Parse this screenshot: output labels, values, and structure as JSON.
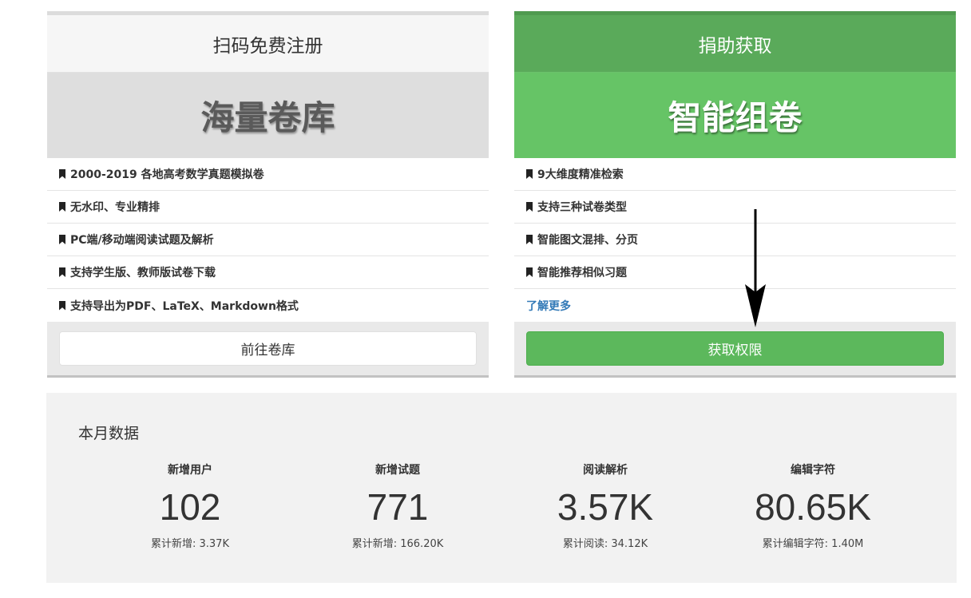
{
  "left_panel": {
    "header": "扫码免费注册",
    "hero": "海量卷库",
    "features": [
      "2000-2019 各地高考数学真题模拟卷",
      "无水印、专业精排",
      "PC端/移动端阅读试题及解析",
      "支持学生版、教师版试卷下载",
      "支持导出为PDF、LaTeX、Markdown格式"
    ],
    "button": "前往卷库"
  },
  "right_panel": {
    "header": "捐助获取",
    "hero": "智能组卷",
    "features": [
      "9大维度精准检索",
      "支持三种试卷类型",
      "智能图文混排、分页",
      "智能推荐相似习题"
    ],
    "more_link": "了解更多",
    "button": "获取权限"
  },
  "stats": {
    "title": "本月数据",
    "items": [
      {
        "label": "新增用户",
        "value": "102",
        "sub": "累计新增: 3.37K"
      },
      {
        "label": "新增试题",
        "value": "771",
        "sub": "累计新增: 166.20K"
      },
      {
        "label": "阅读解析",
        "value": "3.57K",
        "sub": "累计阅读: 34.12K"
      },
      {
        "label": "编辑字符",
        "value": "80.65K",
        "sub": "累计编辑字符: 1.40M"
      }
    ]
  },
  "icons": {
    "feature_bullet": "bookmark-icon",
    "annotation": "arrow-down-icon"
  },
  "colors": {
    "success_green": "#5cb85c",
    "hero_green": "#66c466",
    "link_blue": "#337ab7",
    "stats_bg": "#f2f2f2"
  }
}
